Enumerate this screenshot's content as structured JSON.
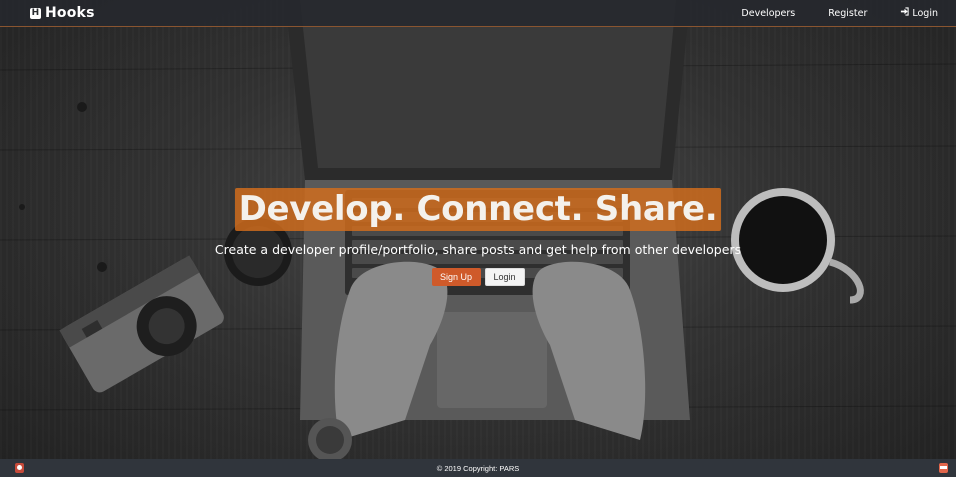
{
  "navbar": {
    "brand_icon_letter": "H",
    "brand": "Hooks",
    "links": [
      {
        "label": "Developers"
      },
      {
        "label": "Register"
      },
      {
        "label": "Login",
        "icon": "sign-in-icon"
      }
    ]
  },
  "hero": {
    "title": "Develop. Connect. Share.",
    "lead": "Create a developer profile/portfolio, share posts and get help from other developers",
    "buttons": {
      "signup": "Sign Up",
      "login": "Login"
    }
  },
  "footer": {
    "text": "© 2019 Copyright: PARS"
  },
  "colors": {
    "accent_orange": "#d46e1c",
    "signup_button": "#cf5a2a",
    "navbar_bg": "#26282d",
    "footer_bg": "#30353c"
  }
}
